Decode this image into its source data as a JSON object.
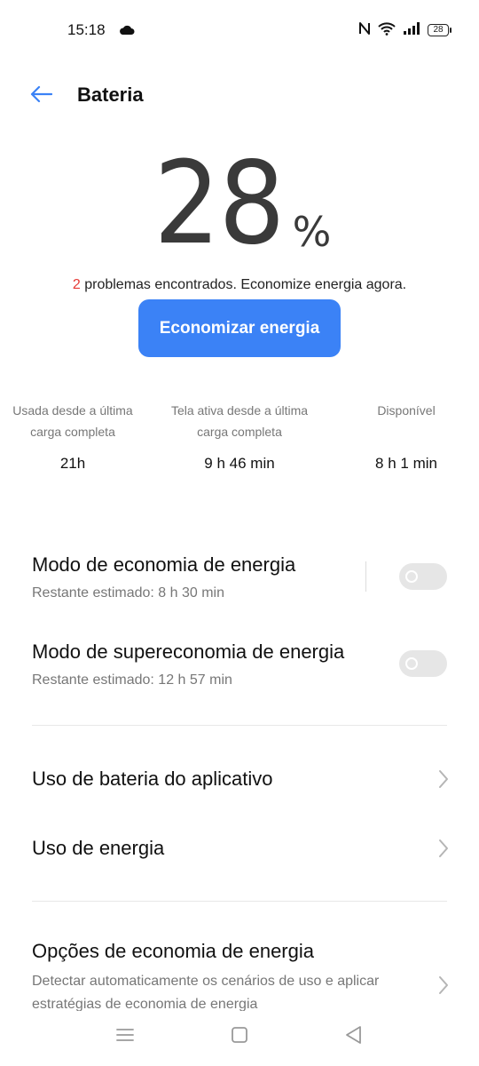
{
  "status_bar": {
    "time": "15:18",
    "battery": "28",
    "icons": [
      "cloud-icon",
      "nfc-icon",
      "wifi-icon",
      "signal-icon",
      "battery-icon"
    ]
  },
  "header": {
    "title": "Bateria",
    "back_icon": "arrow-left-icon"
  },
  "battery": {
    "percent": "28",
    "unit": "%",
    "problems_count": "2",
    "problems_text": " problemas encontrados. Economize energia agora."
  },
  "save_button": {
    "label": "Economizar energia"
  },
  "stats": [
    {
      "label": "Usada desde a última carga completa",
      "value": "21h"
    },
    {
      "label": "Tela ativa desde a última carga completa",
      "value": "9 h 46 min"
    },
    {
      "label": "Disponível",
      "value": "8 h 1 min"
    }
  ],
  "modes": [
    {
      "title": "Modo de economia de energia",
      "subtitle": "Restante estimado:  8 h 30 min",
      "enabled": false
    },
    {
      "title": "Modo de supereconomia de energia",
      "subtitle": "Restante estimado:  12 h 57 min",
      "enabled": false
    }
  ],
  "links": [
    {
      "title": "Uso de bateria do aplicativo"
    },
    {
      "title": "Uso de energia"
    }
  ],
  "options": {
    "title": "Opções de economia de energia",
    "description": "Detectar automaticamente os cenários de uso e aplicar estratégias de economia de energia"
  },
  "colors": {
    "accent": "#3b82f6",
    "alert": "#e53935",
    "toggle_off": "#e6e6e6"
  }
}
